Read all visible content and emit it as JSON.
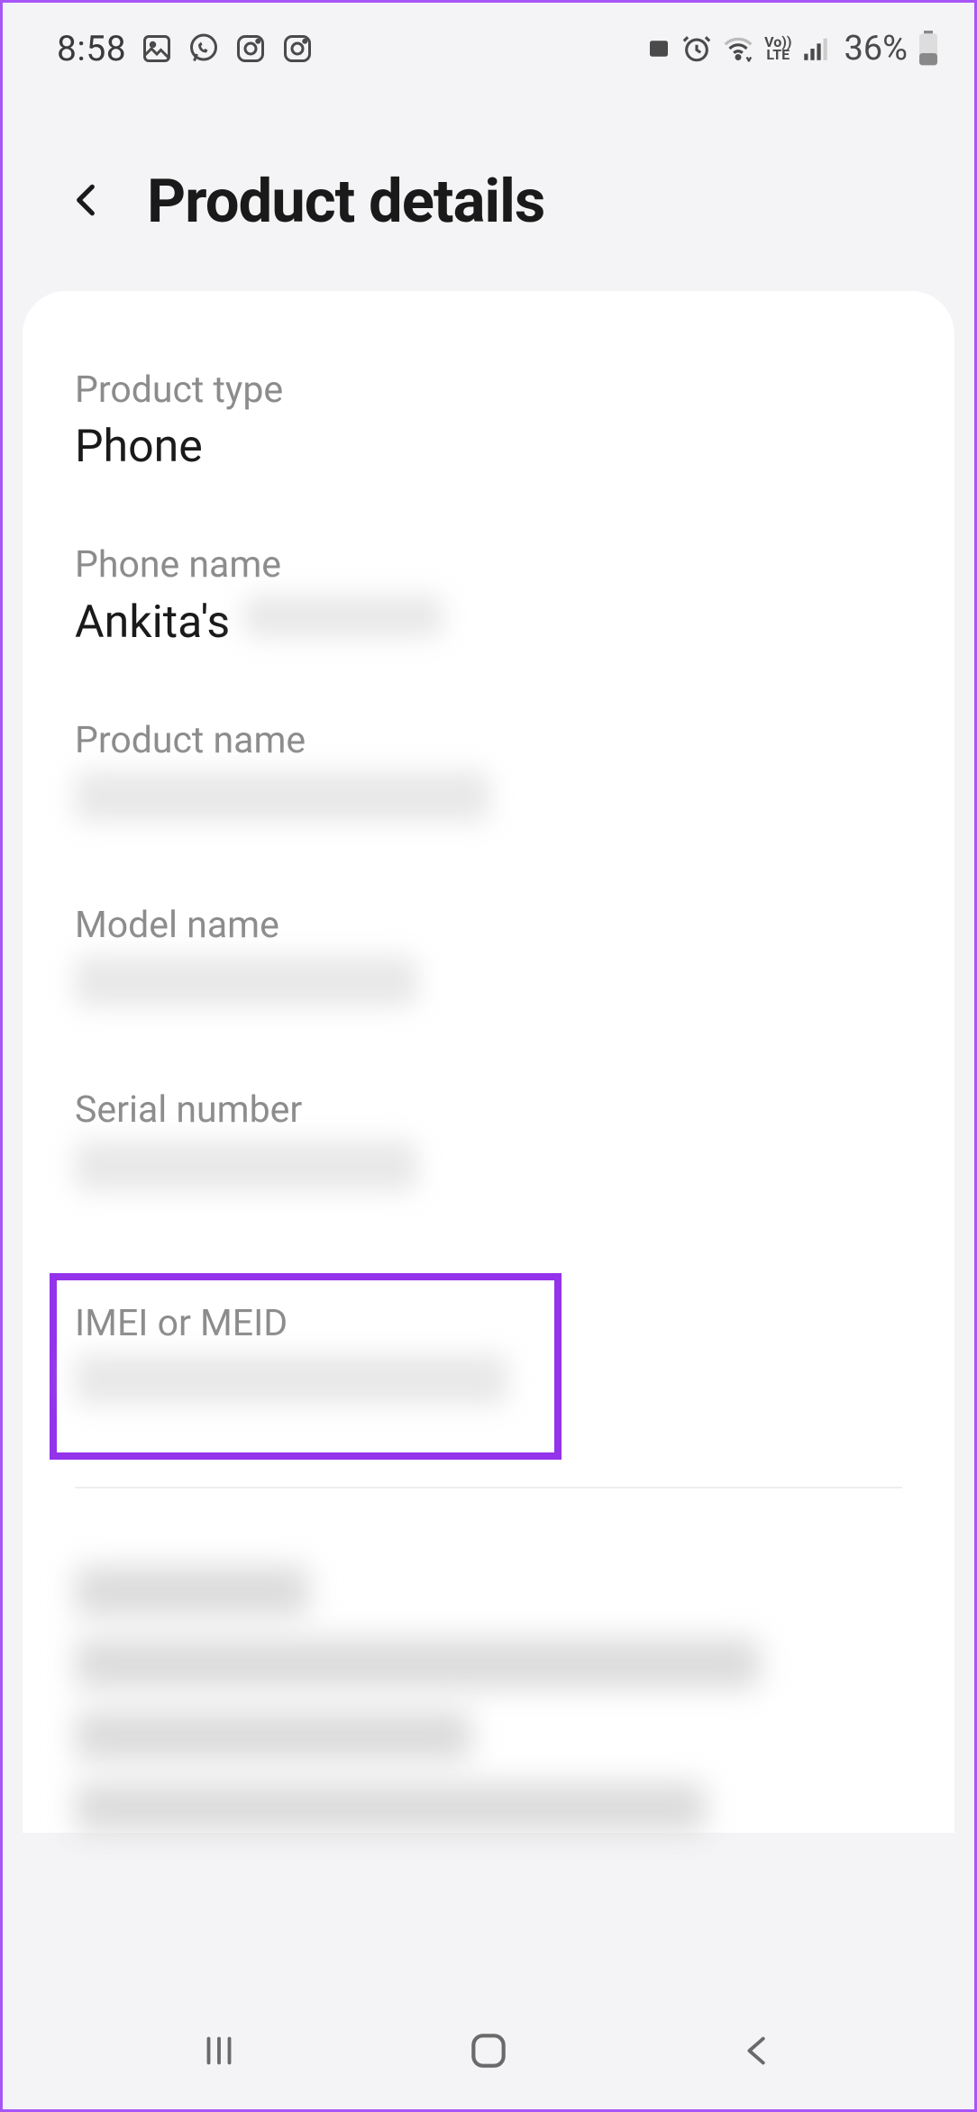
{
  "status": {
    "time": "8:58",
    "battery_pct": "36%",
    "icons_left": [
      "gallery-icon",
      "whatsapp-icon",
      "instagram-icon",
      "instagram-icon"
    ],
    "icons_right": [
      "card-icon",
      "alarm-icon",
      "wifi-icon",
      "volte-icon",
      "signal-icon"
    ]
  },
  "header": {
    "title": "Product details"
  },
  "fields": {
    "product_type": {
      "label": "Product type",
      "value": "Phone"
    },
    "phone_name": {
      "label": "Phone name",
      "value_prefix": "Ankita's",
      "value_suffix_redacted": true
    },
    "product_name": {
      "label": "Product name",
      "value_redacted": true
    },
    "model_name": {
      "label": "Model name",
      "value_redacted": true
    },
    "serial_number": {
      "label": "Serial number",
      "value_redacted": true
    },
    "imei_meid": {
      "label": "IMEI or MEID",
      "value_redacted": true,
      "highlighted": true
    }
  },
  "bottom_section": {
    "lines_redacted": 4
  }
}
